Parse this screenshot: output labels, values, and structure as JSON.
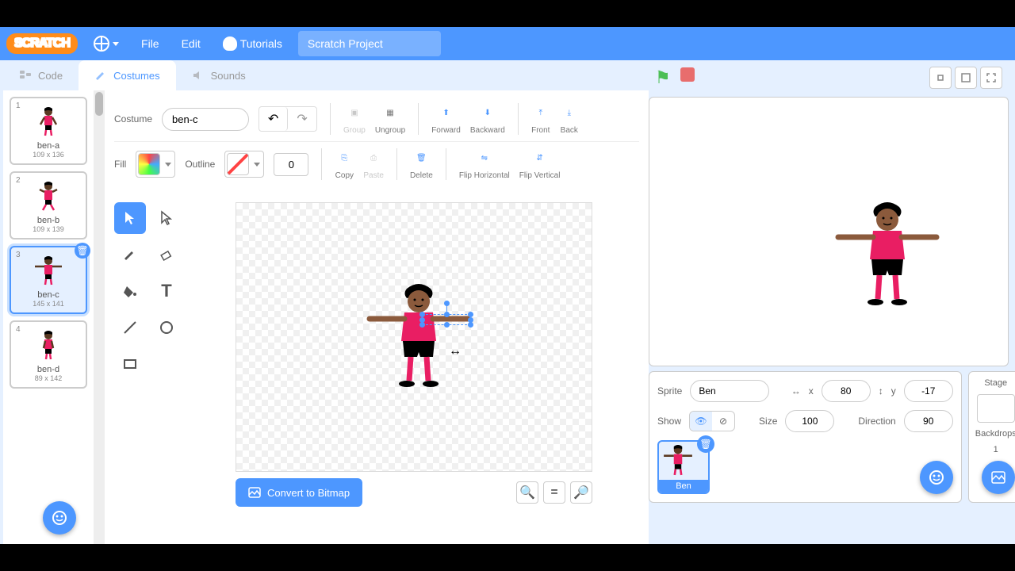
{
  "menubar": {
    "file": "File",
    "edit": "Edit",
    "tutorials": "Tutorials",
    "project_name": "Scratch Project"
  },
  "tabs": {
    "code": "Code",
    "costumes": "Costumes",
    "sounds": "Sounds"
  },
  "costume_editor": {
    "label": "Costume",
    "name": "ben-c",
    "fill_label": "Fill",
    "outline_label": "Outline",
    "outline_width": "0",
    "group": "Group",
    "ungroup": "Ungroup",
    "forward": "Forward",
    "backward": "Backward",
    "front": "Front",
    "back": "Back",
    "copy": "Copy",
    "paste": "Paste",
    "delete": "Delete",
    "flip_h": "Flip Horizontal",
    "flip_v": "Flip Vertical",
    "convert": "Convert to Bitmap"
  },
  "costumes": [
    {
      "num": "1",
      "name": "ben-a",
      "dim": "109 x 136"
    },
    {
      "num": "2",
      "name": "ben-b",
      "dim": "109 x 139"
    },
    {
      "num": "3",
      "name": "ben-c",
      "dim": "145 x 141"
    },
    {
      "num": "4",
      "name": "ben-d",
      "dim": "89 x 142"
    }
  ],
  "sprite_info": {
    "sprite_label": "Sprite",
    "name": "Ben",
    "x_label": "x",
    "x": "80",
    "y_label": "y",
    "y": "-17",
    "show_label": "Show",
    "size_label": "Size",
    "size": "100",
    "direction_label": "Direction",
    "direction": "90"
  },
  "stage_panel": {
    "title": "Stage",
    "backdrops_label": "Backdrops",
    "backdrops_count": "1"
  },
  "sprite_tile": {
    "name": "Ben"
  }
}
